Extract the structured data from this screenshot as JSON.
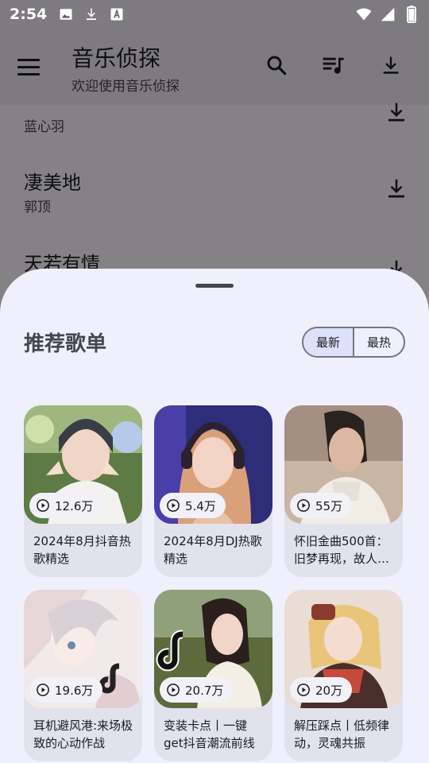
{
  "status_bar": {
    "time": "2:54",
    "left_icons": [
      "image-icon",
      "download-icon",
      "font-icon"
    ],
    "right_icons": [
      "wifi-icon",
      "signal-icon",
      "battery-icon"
    ]
  },
  "app_bar": {
    "title": "音乐侦探",
    "subtitle": "欢迎使用音乐侦探",
    "icons": [
      "menu-icon",
      "search-icon",
      "queue-music-icon",
      "download-icon"
    ]
  },
  "songs": [
    {
      "title": "",
      "artist": "蓝心羽"
    },
    {
      "title": "凄美地",
      "artist": "郭顶"
    },
    {
      "title": "天若有情",
      "artist": ""
    }
  ],
  "sheet": {
    "title": "推荐歌单",
    "segments": [
      {
        "label": "最新",
        "selected": true
      },
      {
        "label": "最热",
        "selected": false
      }
    ]
  },
  "playlists": [
    {
      "plays": "12.6万",
      "title": "2024年8月抖音热歌精选"
    },
    {
      "plays": "5.4万",
      "title": "2024年8月DJ热歌精选"
    },
    {
      "plays": "55万",
      "title": "怀旧金曲500首：旧梦再现，故人…"
    },
    {
      "plays": "19.6万",
      "title": "耳机避风港:来场极致的心动作战"
    },
    {
      "plays": "20.7万",
      "title": "变装卡点丨一键get抖音潮流前线"
    },
    {
      "plays": "20万",
      "title": "解压踩点丨低频律动，灵魂共振"
    }
  ],
  "colors": {
    "sheet_bg": "#eff0fb",
    "card_bg": "#e1e2ec",
    "segment_selected": "#dde1f9",
    "scrim": "rgba(0,0,0,0.48)"
  }
}
